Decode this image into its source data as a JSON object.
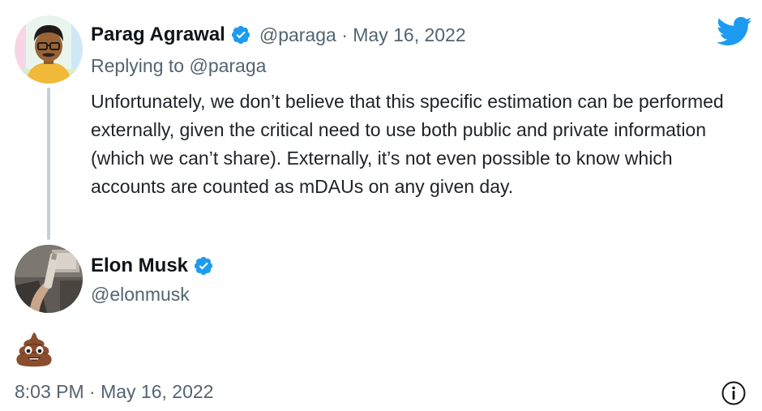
{
  "parent_tweet": {
    "author_name": "Parag Agrawal",
    "handle": "@paraga",
    "separator": "·",
    "date": "May 16, 2022",
    "replying_prefix": "Replying to",
    "replying_to": "@paraga",
    "text": "Unfortunately, we don’t believe that this specific estimation can be performed externally, given the critical need to use both public and private information (which we can’t share). Externally, it’s not even possible to know which accounts are counted as mDAUs on any given day."
  },
  "reply_tweet": {
    "author_name": "Elon Musk",
    "handle": "@elonmusk",
    "content_emoji": "pile-of-poo-emoji",
    "timestamp": "8:03 PM · May 16, 2022"
  },
  "icons": {
    "verified": "verified-badge-icon",
    "brand": "twitter-bird-icon",
    "info": "info-icon"
  },
  "colors": {
    "brand_blue": "#1d9bf0",
    "text_primary": "#0f1419",
    "text_secondary": "#536471",
    "thread_line": "#c4cfd6"
  }
}
